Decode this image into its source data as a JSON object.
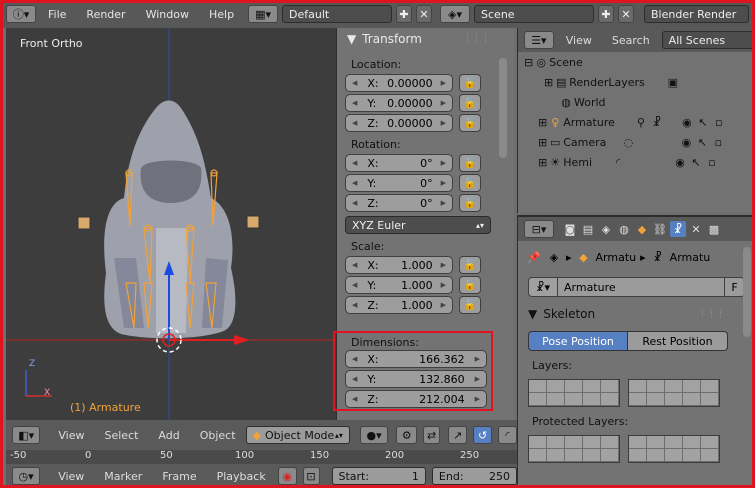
{
  "topbar": {
    "menus": [
      "File",
      "Render",
      "Window",
      "Help"
    ],
    "layout": "Default",
    "scene": "Scene",
    "engine": "Blender Render"
  },
  "viewport": {
    "view_label": "Front Ortho",
    "object_label": "(1) Armature",
    "axis_z": "Z",
    "axis_x": "X"
  },
  "transform": {
    "title": "Transform",
    "location_label": "Location:",
    "location": [
      {
        "axis": "X:",
        "value": "0.00000"
      },
      {
        "axis": "Y:",
        "value": "0.00000"
      },
      {
        "axis": "Z:",
        "value": "0.00000"
      }
    ],
    "rotation_label": "Rotation:",
    "rotation": [
      {
        "axis": "X:",
        "value": "0°"
      },
      {
        "axis": "Y:",
        "value": "0°"
      },
      {
        "axis": "Z:",
        "value": "0°"
      }
    ],
    "rotation_mode": "XYZ Euler",
    "scale_label": "Scale:",
    "scale": [
      {
        "axis": "X:",
        "value": "1.000"
      },
      {
        "axis": "Y:",
        "value": "1.000"
      },
      {
        "axis": "Z:",
        "value": "1.000"
      }
    ],
    "dimensions_label": "Dimensions:",
    "dimensions": [
      {
        "axis": "X:",
        "value": "166.362"
      },
      {
        "axis": "Y:",
        "value": "132.860"
      },
      {
        "axis": "Z:",
        "value": "212.004"
      }
    ]
  },
  "outliner": {
    "view": "View",
    "search": "Search",
    "filter": "All Scenes",
    "items": [
      "Scene",
      "RenderLayers",
      "World",
      "Armature",
      "Camera",
      "Hemi"
    ]
  },
  "properties": {
    "breadcrumb_1": "Armatu",
    "breadcrumb_2": "Armatu",
    "name_field": "Armature",
    "fake_user": "F",
    "section": "Skeleton",
    "pose_position": "Pose Position",
    "rest_position": "Rest Position",
    "layers": "Layers:",
    "protected_layers": "Protected Layers:"
  },
  "bottom_header": {
    "view": "View",
    "select": "Select",
    "add": "Add",
    "object": "Object",
    "mode": "Object Mode"
  },
  "timeline": {
    "ticks": [
      "-50",
      "0",
      "50",
      "100",
      "150",
      "200",
      "250"
    ]
  },
  "bottom_header2": {
    "view": "View",
    "marker": "Marker",
    "frame": "Frame",
    "playback": "Playback",
    "start_label": "Start:",
    "start_value": "1",
    "end_label": "End:",
    "end_value": "250"
  },
  "colors": {
    "highlight_box": "#e0141e",
    "accent_blue": "#5680c2",
    "bone_orange": "#f1a23a"
  }
}
